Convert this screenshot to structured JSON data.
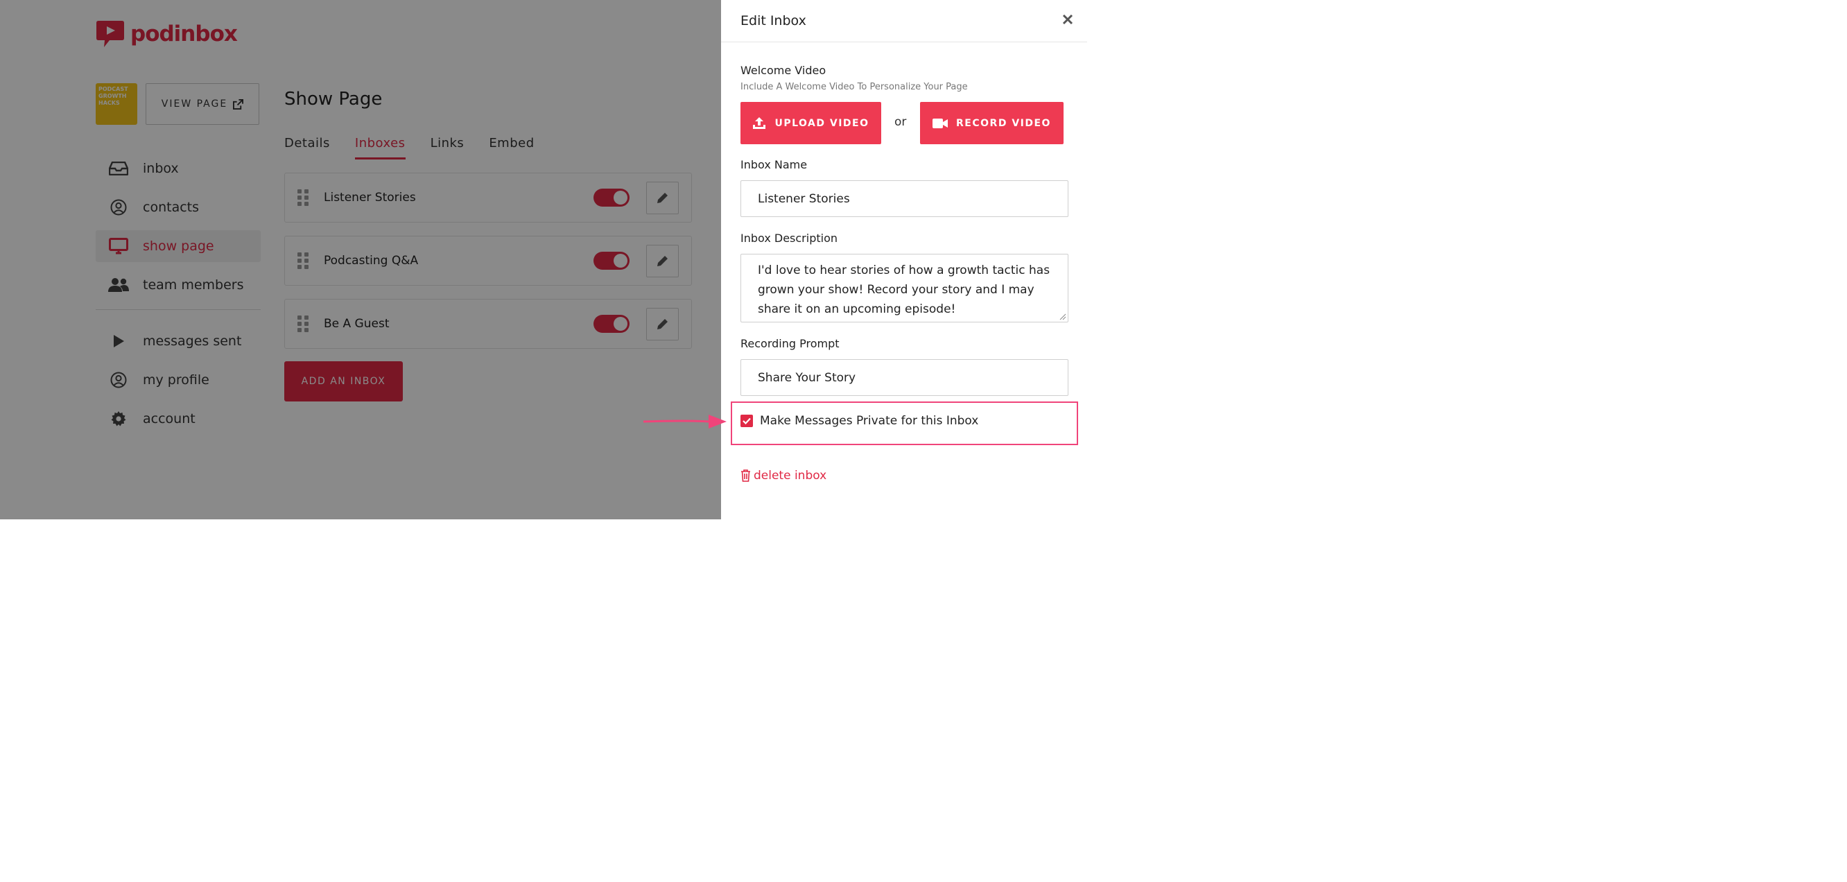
{
  "app": {
    "brand": "podinbox",
    "avatar_text": "PODCAST GROWTH HACKS",
    "view_page_label": "VIEW PAGE",
    "nav": [
      {
        "label": "inbox",
        "icon": "inbox-icon"
      },
      {
        "label": "contacts",
        "icon": "user-circle-icon"
      },
      {
        "label": "show page",
        "icon": "monitor-icon",
        "active": true
      },
      {
        "label": "team members",
        "icon": "users-icon"
      },
      {
        "label": "messages sent",
        "icon": "play-icon"
      },
      {
        "label": "my profile",
        "icon": "user-circle-icon"
      },
      {
        "label": "account",
        "icon": "gear-icon"
      }
    ],
    "page_title": "Show Page",
    "tabs": [
      {
        "label": "Details"
      },
      {
        "label": "Inboxes",
        "active": true
      },
      {
        "label": "Links"
      },
      {
        "label": "Embed"
      }
    ],
    "inboxes": [
      {
        "name": "Listener Stories",
        "enabled": true
      },
      {
        "name": "Podcasting Q&A",
        "enabled": true
      },
      {
        "name": "Be A Guest",
        "enabled": true
      }
    ],
    "add_inbox_label": "ADD AN INBOX"
  },
  "panel": {
    "title": "Edit Inbox",
    "welcome_video_label": "Welcome Video",
    "welcome_video_sub": "Include A Welcome Video To Personalize Your Page",
    "upload_label": "UPLOAD VIDEO",
    "or_text": "or",
    "record_label": "RECORD VIDEO",
    "inbox_name_label": "Inbox Name",
    "inbox_name_value": "Listener Stories",
    "inbox_description_label": "Inbox Description",
    "inbox_description_value": "I'd love to hear stories of how a growth tactic has grown your show! Record your story and I may share it on an upcoming episode!",
    "recording_prompt_label": "Recording Prompt",
    "recording_prompt_value": "Share Your Story",
    "private_label": "Make Messages Private for this Inbox",
    "private_checked": true,
    "delete_label": "delete inbox"
  },
  "colors": {
    "brand_red": "#e02945",
    "button_red": "#ee3a52",
    "highlight_pink": "#f0447a"
  }
}
